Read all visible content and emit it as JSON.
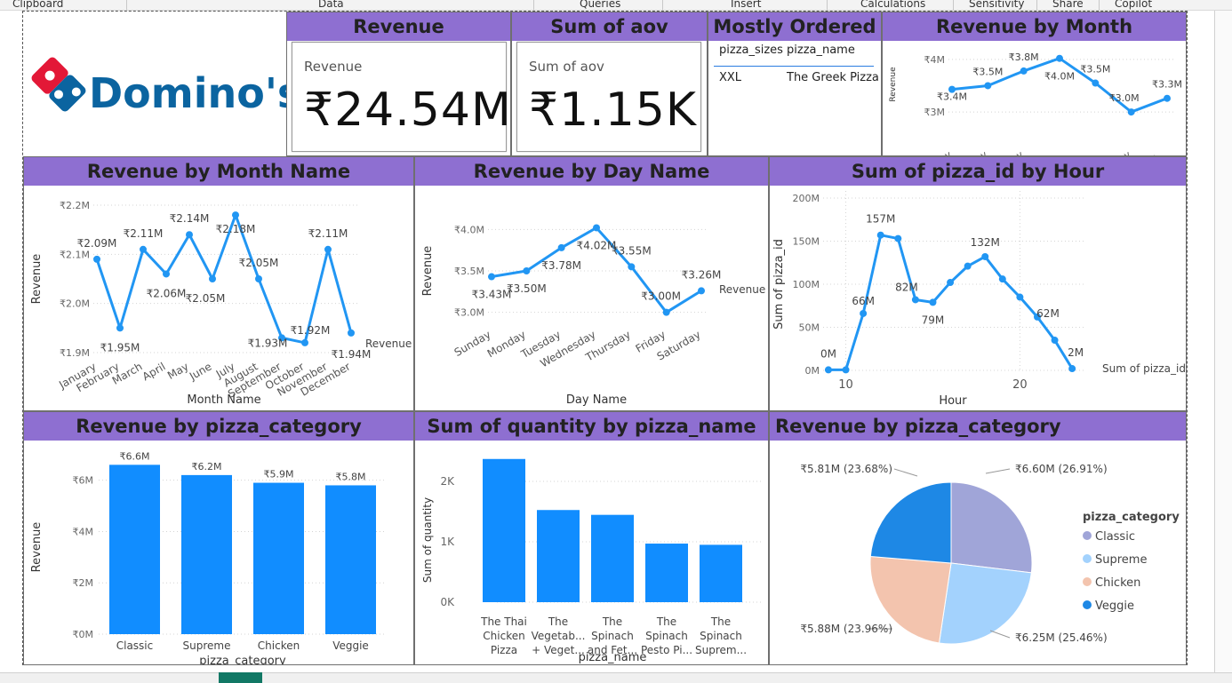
{
  "ribbon": {
    "groups": [
      "Clipboard",
      "Data",
      "Queries",
      "Insert",
      "Calculations",
      "Sensitivity",
      "Share",
      "Copilot"
    ]
  },
  "brand": {
    "name": "Domino's",
    "logo_icon": "dominos-logo-icon",
    "color_blue": "#0b64a0",
    "color_red": "#e31837"
  },
  "colors": {
    "accent": "#8e6fd1",
    "series": "#2196f3",
    "bar": "#118dff"
  },
  "kpi_revenue": {
    "title": "Revenue",
    "label": "Revenue",
    "value": "₹24.54M"
  },
  "kpi_aov": {
    "title": "Sum of aov",
    "label": "Sum of aov",
    "value": "₹1.15K"
  },
  "mostly_ordered": {
    "title": "Mostly Ordered",
    "columns": [
      "pizza_sizes",
      "pizza_name"
    ],
    "rows": [
      [
        "XXL",
        "The Greek Pizza"
      ]
    ]
  },
  "chart_data": [
    {
      "type": "line",
      "title": "Revenue by Month",
      "ylabel": "Revenue",
      "categories": [
        "Sunday",
        "Monday",
        "Tuesday",
        "Wedn...",
        "Thurs...",
        "Friday",
        "Saturd..."
      ],
      "values": [
        3.43,
        3.5,
        3.78,
        4.02,
        3.55,
        3.0,
        3.26
      ],
      "data_labels": [
        "₹3.4M",
        "₹3.5M",
        "₹3.8M",
        "₹4.0M",
        "₹3.5M",
        "₹3.0M",
        "₹3.3M"
      ],
      "yticks": [
        "₹3M",
        "₹4M"
      ],
      "ylim": [
        2.9,
        4.15
      ]
    },
    {
      "type": "line",
      "title": "Revenue by Month Name",
      "xlabel": "Month Name",
      "ylabel": "Revenue",
      "series_label": "Revenue",
      "categories": [
        "January",
        "February",
        "March",
        "April",
        "May",
        "June",
        "July",
        "August",
        "September",
        "October",
        "November",
        "December"
      ],
      "values": [
        2.09,
        1.95,
        2.11,
        2.06,
        2.14,
        2.05,
        2.18,
        2.05,
        1.93,
        1.92,
        2.11,
        1.94
      ],
      "data_labels": [
        "₹2.09M",
        "₹1.95M",
        "₹2.11M",
        "₹2.06M",
        "₹2.14M",
        "₹2.05M",
        "₹2.18M",
        "₹2.05M",
        "₹1.93M",
        "₹1.92M",
        "₹2.11M",
        "₹1.94M"
      ],
      "yticks": [
        "₹1.9M",
        "₹2.0M",
        "₹2.1M",
        "₹2.2M"
      ],
      "ylim": [
        1.9,
        2.2
      ]
    },
    {
      "type": "line",
      "title": "Revenue by Day Name",
      "xlabel": "Day Name",
      "ylabel": "Revenue",
      "series_label": "Revenue",
      "categories": [
        "Sunday",
        "Monday",
        "Tuesday",
        "Wednesday",
        "Thursday",
        "Friday",
        "Saturday"
      ],
      "values": [
        3.43,
        3.5,
        3.78,
        4.02,
        3.55,
        3.0,
        3.26
      ],
      "data_labels": [
        "₹3.43M",
        "₹3.50M",
        "₹3.78M",
        "₹4.02M",
        "₹3.55M",
        "₹3.00M",
        "₹3.26M"
      ],
      "yticks": [
        "₹3.0M",
        "₹3.5M",
        "₹4.0M"
      ],
      "ylim": [
        2.9,
        4.1
      ]
    },
    {
      "type": "line",
      "title": "Sum of pizza_id by Hour",
      "xlabel": "Hour",
      "ylabel": "Sum of pizza_id",
      "series_label": "Sum of pizza_id",
      "x": [
        9,
        10,
        11,
        12,
        13,
        14,
        15,
        16,
        17,
        18,
        19,
        20,
        21,
        22,
        23
      ],
      "values": [
        0.6,
        0.6,
        66,
        157,
        153,
        82,
        79,
        102,
        121,
        132,
        106,
        85,
        62,
        35,
        2
      ],
      "data_labels": [
        "0M",
        "",
        "66M",
        "157M",
        "",
        "82M",
        "79M",
        "",
        "",
        "132M",
        "",
        "",
        "62M",
        "",
        "2M"
      ],
      "yticks": [
        "0M",
        "50M",
        "100M",
        "150M",
        "200M"
      ],
      "xticks": [
        "10",
        "20"
      ],
      "ylim": [
        0,
        200
      ],
      "xlim": [
        8.9,
        23.4
      ]
    },
    {
      "type": "bar",
      "title": "Revenue by pizza_category",
      "xlabel": "pizza_category",
      "ylabel": "Revenue",
      "categories": [
        "Classic",
        "Supreme",
        "Chicken",
        "Veggie"
      ],
      "values": [
        6.6,
        6.2,
        5.9,
        5.8
      ],
      "data_labels": [
        "₹6.6M",
        "₹6.2M",
        "₹5.9M",
        "₹5.8M"
      ],
      "yticks": [
        "₹0M",
        "₹2M",
        "₹4M",
        "₹6M"
      ],
      "ylim": [
        0,
        7.2
      ]
    },
    {
      "type": "bar",
      "title": "Sum of quantity by pizza_name",
      "xlabel": "pizza_name",
      "ylabel": "Sum of quantity",
      "categories": [
        [
          "The Thai",
          "Chicken",
          "Pizza"
        ],
        [
          "The",
          "Vegetab...",
          "+ Veget..."
        ],
        [
          "The",
          "Spinach",
          "and Fet..."
        ],
        [
          "The",
          "Spinach",
          "Pesto Pi..."
        ],
        [
          "The",
          "Spinach",
          "Suprem..."
        ]
      ],
      "values": [
        2371,
        1526,
        1446,
        970,
        950
      ],
      "yticks": [
        "0K",
        "1K",
        "2K"
      ],
      "ylim": [
        0,
        2500
      ]
    },
    {
      "type": "pie",
      "title": "Revenue by pizza_category",
      "legend_title": "pizza_category",
      "categories": [
        "Classic",
        "Supreme",
        "Chicken",
        "Veggie"
      ],
      "values": [
        26.91,
        25.46,
        23.96,
        23.68
      ],
      "data_labels": [
        "₹6.60M (26.91%)",
        "₹6.25M (25.46%)",
        "₹5.88M (23.96%)",
        "₹5.81M (23.68%)"
      ],
      "colors": [
        "#a0a5d8",
        "#a3d2fd",
        "#f3c4ae",
        "#1e88e5"
      ],
      "legend_position": "right"
    }
  ]
}
